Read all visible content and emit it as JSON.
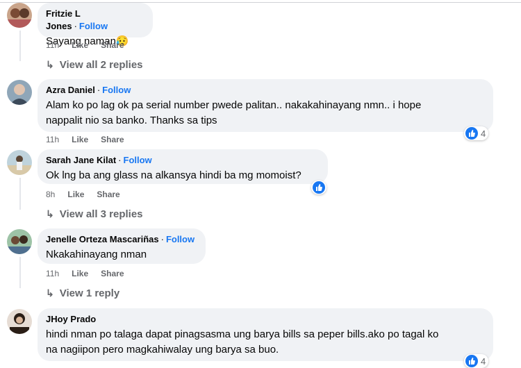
{
  "ui": {
    "follow_label": "Follow",
    "like_label": "Like",
    "share_label": "Share",
    "colors": {
      "link": "#1877f2",
      "bubble": "#f0f2f5",
      "meta": "#65676b",
      "reaction": "#1877f2"
    }
  },
  "comments": [
    {
      "author": "Fritzie L Jones",
      "text": "Sayang naman😥",
      "time": "11h",
      "replies_link": "View all 2 replies"
    },
    {
      "author": "Azra Daniel",
      "text_line1": "Alam ko po lag ok pa serial number pwede palitan.. nakakahinayang nmn.. i hope",
      "text_line2": "nappalit nio sa banko. Thanks sa tips",
      "time": "11h",
      "reaction_count": "4",
      "reaction_icon": "like-icon"
    },
    {
      "author": "Sarah Jane Kilat",
      "text": "Ok lng ba ang glass na alkansya hindi ba mg momoist?",
      "time": "8h",
      "reaction_icon": "like-icon",
      "replies_link": "View all 3 replies"
    },
    {
      "author": "Jenelle Orteza Mascariñas",
      "text": "Nkakahinayang nman",
      "time": "11h",
      "replies_link": "View 1 reply"
    },
    {
      "author": "JHoy Prado",
      "text_line1": "hindi nman po talaga dapat pinagsasma ung barya bills sa peper bills.ako po tagal ko",
      "text_line2": "na nagiipon pero magkahiwalay ung barya sa buo.",
      "reaction_count": "4",
      "reaction_icon": "like-icon"
    }
  ]
}
